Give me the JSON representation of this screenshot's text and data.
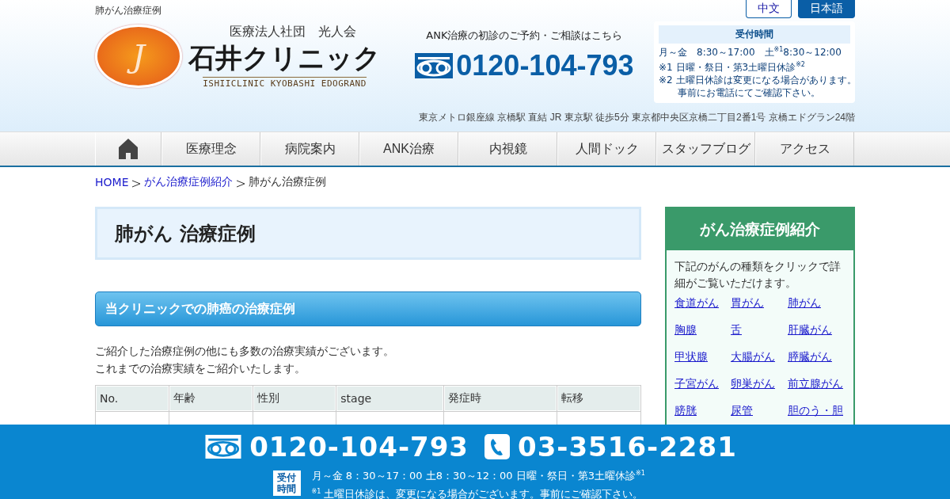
{
  "top_label": "肺がん治療症例",
  "languages": [
    {
      "label": "中文",
      "selected": false
    },
    {
      "label": "日本語",
      "selected": true
    }
  ],
  "logo": {
    "mark": "J",
    "org": "医療法人社団　光人会",
    "name": "石井クリニック",
    "subtitle": "ISHIICLINIC KYOBASHI EDOGRAND"
  },
  "contact": {
    "caption": "ANK治療の初診のご予約・ご相談はこちら",
    "phone": "0120-104-793"
  },
  "hours": {
    "title": "受付時間",
    "lines": [
      "月～金　8:30～17:00　土$^{※1}$8:30～12:00",
      "※1 日曜・祭日・第3土曜日休診$^{※2}$",
      "※2 土曜日休診は変更になる場合があります。",
      "　　事前にお電話にてご確認下さい。"
    ]
  },
  "address": "東京メトロ銀座線 京橋駅 直結 JR 東京駅 徒歩5分 東京都中央区京橋二丁目2番1号 京橋エドグラン24階",
  "nav_items": [
    "医療理念",
    "病院案内",
    "ANK治療",
    "内視鏡",
    "人間ドック",
    "スタッフブログ",
    "アクセス"
  ],
  "breadcrumb": [
    {
      "label": "HOME",
      "link": true
    },
    {
      "label": "がん治療症例紹介",
      "link": true
    },
    {
      "label": "肺がん治療症例",
      "link": false
    }
  ],
  "page_title": "肺がん 治療症例",
  "section_heading": "当クリニックでの肺癌の治療症例",
  "intro": [
    "ご紹介した治療症例の他にも多数の治療実績がございます。",
    "これまでの治療実績をご紹介いたします。"
  ],
  "table": {
    "columns": [
      "No.",
      "年齢",
      "性別",
      "stage",
      "発症時",
      "転移"
    ]
  },
  "sidebar": {
    "title": "がん治療症例紹介",
    "description": "下記のがんの種類をクリックで詳細がご覧いただけます。",
    "links": [
      "食道がん",
      "胃がん",
      "肺がん",
      "胸腺",
      "舌",
      "肝臓がん",
      "甲状腺",
      "大腸がん",
      "膵臓がん",
      "子宮がん",
      "卵巣がん",
      "前立腺がん",
      "膀胱",
      "尿管",
      "胆のう・胆"
    ]
  },
  "footer": {
    "free_dial": "0120-104-793",
    "phone": "03-3516-2281",
    "badge": "受付時間",
    "lines": [
      "月～金 8：30～17：00  土8：30～12：00 日曜・祭日・第3土曜休診$^{※1}$",
      "$^{※1}$ 土曜日休診は、変更になる場合がございます。事前にご確認下さい。"
    ]
  }
}
